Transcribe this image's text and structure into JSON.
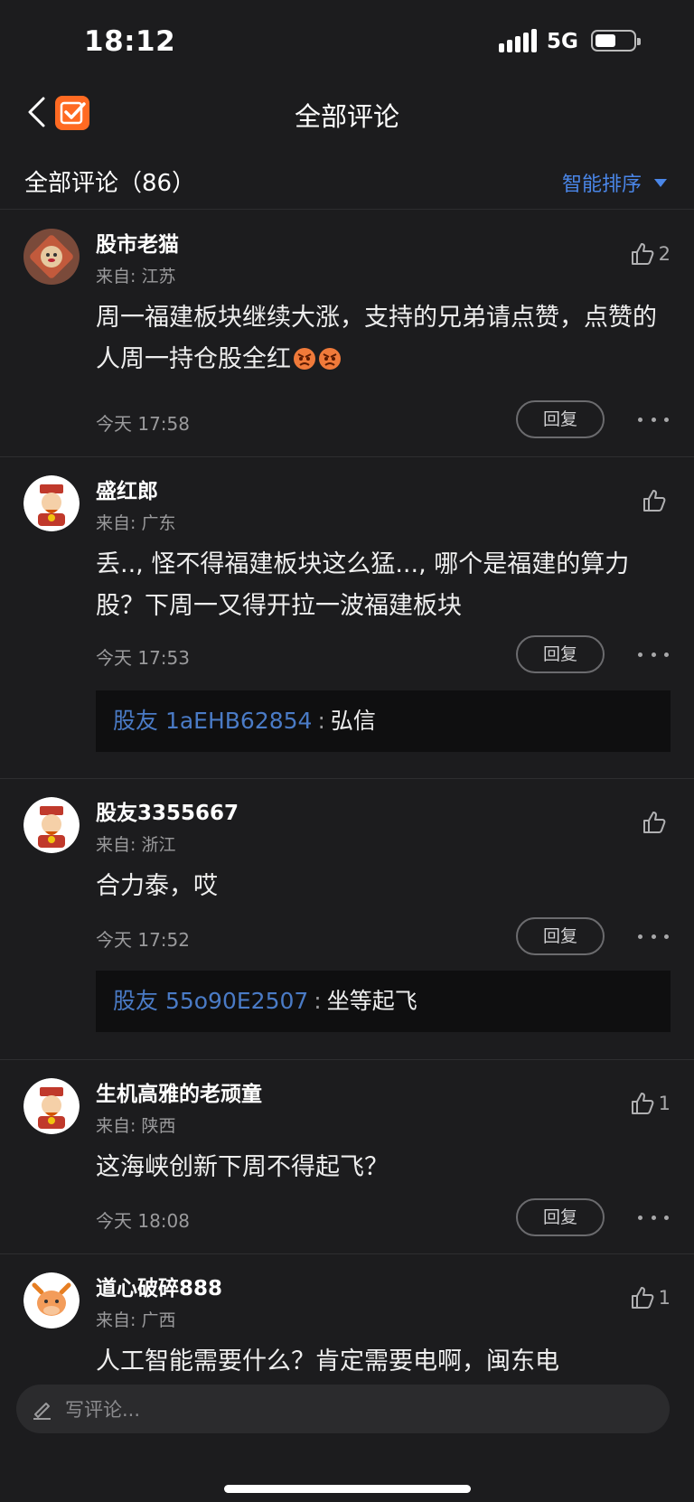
{
  "status_bar": {
    "time": "18:12",
    "network": "5G"
  },
  "nav": {
    "title": "全部评论"
  },
  "header": {
    "count_label": "全部评论（86）",
    "sort_label": "智能排序"
  },
  "comments": [
    {
      "user": "股市老猫",
      "location": "来自: 江苏",
      "likes": "2",
      "text": "周一福建板块继续大涨，支持的兄弟请点赞，点赞的人周一持仓股全红",
      "time": "今天 17:58",
      "reply_label": "回复"
    },
    {
      "user": "盛红郎",
      "location": "来自: 广东",
      "likes": "",
      "text": "丢.., 怪不得福建板块这么猛..., 哪个是福建的算力股？下周一又得开拉一波福建板块",
      "time": "今天 17:53",
      "reply_label": "回复",
      "sub_reply": {
        "user": "股友 1aEHB62854",
        "text": "弘信"
      }
    },
    {
      "user": "股友3355667",
      "location": "来自: 浙江",
      "likes": "",
      "text": "合力泰，哎",
      "time": "今天 17:52",
      "reply_label": "回复",
      "sub_reply": {
        "user": "股友 55o90E2507",
        "text": "坐等起飞"
      }
    },
    {
      "user": "生机高雅的老顽童",
      "location": "来自: 陕西",
      "likes": "1",
      "text": "这海峡创新下周不得起飞？",
      "time": "今天 18:08",
      "reply_label": "回复"
    },
    {
      "user": "道心破碎888",
      "location": "来自: 广西",
      "likes": "1",
      "text": "人工智能需要什么？肯定需要电啊，闽东电"
    }
  ],
  "composer": {
    "placeholder": "写评论..."
  },
  "colors": {
    "background": "#1c1c1e",
    "accent": "#4a86e8",
    "reply_user": "#4a7bc6",
    "brand": "#ff6a22"
  },
  "icons": [
    "back-icon",
    "app-check-icon",
    "thumb-up-icon",
    "more-icon",
    "pencil-icon",
    "angry-emoji-icon"
  ]
}
